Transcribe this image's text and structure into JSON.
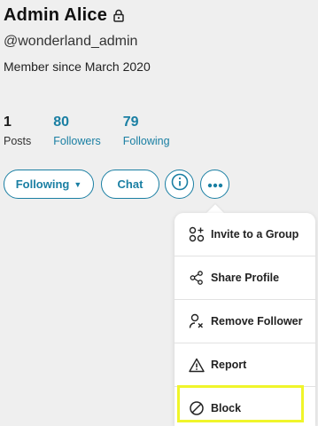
{
  "profile": {
    "name": "Admin Alice",
    "handle": "@wonderland_admin",
    "member_since": "Member since March 2020"
  },
  "stats": [
    {
      "count": "1",
      "label": "Posts"
    },
    {
      "count": "80",
      "label": "Followers"
    },
    {
      "count": "79",
      "label": "Following"
    }
  ],
  "actions": {
    "following_label": "Following",
    "chat_label": "Chat"
  },
  "menu": {
    "items": [
      {
        "label": "Invite to a Group",
        "icon": "invite-group-icon"
      },
      {
        "label": "Share Profile",
        "icon": "share-icon"
      },
      {
        "label": "Remove Follower",
        "icon": "remove-follower-icon"
      },
      {
        "label": "Report",
        "icon": "warning-icon"
      },
      {
        "label": "Block",
        "icon": "block-icon"
      }
    ]
  },
  "colors": {
    "accent": "#1a7fa3",
    "highlight": "#f0f52a",
    "background": "#efefef"
  }
}
